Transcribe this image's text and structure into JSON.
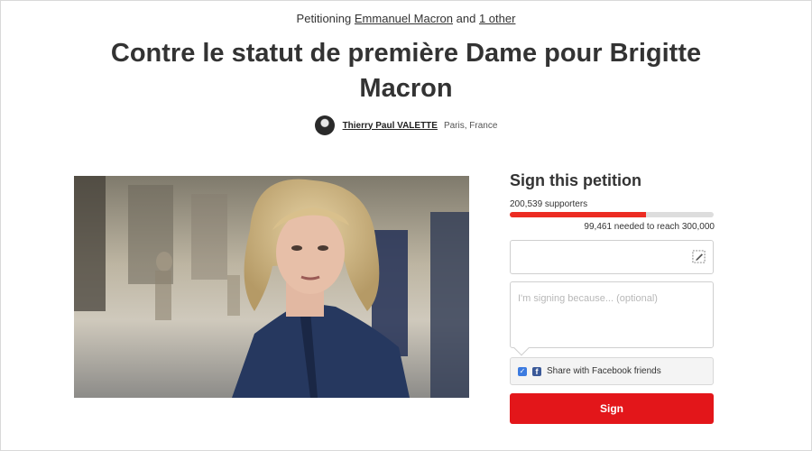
{
  "header": {
    "prefix": "Petitioning",
    "target": "Emmanuel Macron",
    "conjunction": "and",
    "others": "1 other"
  },
  "petition": {
    "title": "Contre le statut de première Dame pour Brigitte Macron",
    "author_name": "Thierry Paul VALETTE",
    "author_location": "Paris, France"
  },
  "sign": {
    "heading": "Sign this petition",
    "supporters": "200,539 supporters",
    "progress_fraction": 0.668,
    "needed": "99,461 needed to reach 300,000",
    "reason_placeholder": "I'm signing because... (optional)",
    "facebook_label": "Share with Facebook friends",
    "facebook_checked": true,
    "button_label": "Sign"
  },
  "colors": {
    "accent_red": "#e3161a",
    "progress_red": "#ec2c22",
    "facebook_blue": "#3b5998",
    "checkbox_blue": "#3c7be0"
  },
  "icons": {
    "signature": "pen-signature-icon",
    "checkbox": "checkmark-icon",
    "facebook": "facebook-icon",
    "avatar": "user-avatar"
  }
}
